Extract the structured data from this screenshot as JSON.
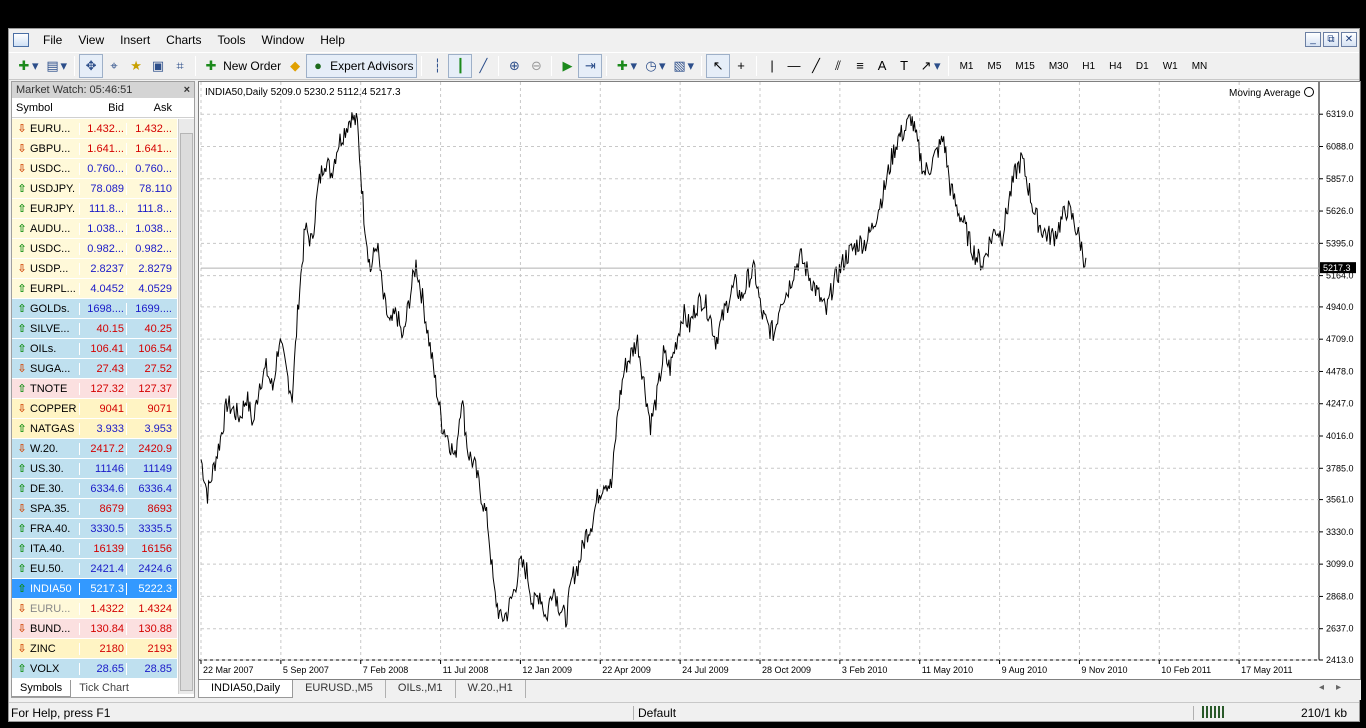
{
  "menu": [
    "File",
    "View",
    "Insert",
    "Charts",
    "Tools",
    "Window",
    "Help"
  ],
  "window_controls": [
    "_",
    "⧉",
    "✕"
  ],
  "toolbar": {
    "new_order": "New Order",
    "expert_advisors": "Expert Advisors",
    "timeframes": [
      "M1",
      "M5",
      "M15",
      "M30",
      "H1",
      "H4",
      "D1",
      "W1",
      "MN"
    ]
  },
  "market_watch": {
    "title": "Market Watch: 05:46:51",
    "close": "×",
    "headers": {
      "symbol": "Symbol",
      "bid": "Bid",
      "ask": "Ask"
    },
    "rows": [
      {
        "symbol": "EURU...",
        "bid": "1.432...",
        "ask": "1.432...",
        "dir": "down",
        "color": "red",
        "bg": "#fff9d9"
      },
      {
        "symbol": "GBPU...",
        "bid": "1.641...",
        "ask": "1.641...",
        "dir": "down",
        "color": "red",
        "bg": "#fff9d9"
      },
      {
        "symbol": "USDC...",
        "bid": "0.760...",
        "ask": "0.760...",
        "dir": "down",
        "color": "blue",
        "bg": "#fff9d9"
      },
      {
        "symbol": "USDJPY.",
        "bid": "78.089",
        "ask": "78.110",
        "dir": "up",
        "color": "blue",
        "bg": "#fff9d9"
      },
      {
        "symbol": "EURJPY.",
        "bid": "111.8...",
        "ask": "111.8...",
        "dir": "up",
        "color": "blue",
        "bg": "#fff9d9"
      },
      {
        "symbol": "AUDU...",
        "bid": "1.038...",
        "ask": "1.038...",
        "dir": "up",
        "color": "blue",
        "bg": "#fff9d9"
      },
      {
        "symbol": "USDC...",
        "bid": "0.982...",
        "ask": "0.982...",
        "dir": "up",
        "color": "blue",
        "bg": "#fff9d9"
      },
      {
        "symbol": "USDP...",
        "bid": "2.8237",
        "ask": "2.8279",
        "dir": "down",
        "color": "blue",
        "bg": "#fff9d9"
      },
      {
        "symbol": "EURPL...",
        "bid": "4.0452",
        "ask": "4.0529",
        "dir": "up",
        "color": "blue",
        "bg": "#fff9d9"
      },
      {
        "symbol": "GOLDs.",
        "bid": "1698....",
        "ask": "1699....",
        "dir": "up",
        "color": "blue",
        "bg": "#bfe0ef"
      },
      {
        "symbol": "SILVE...",
        "bid": "40.15",
        "ask": "40.25",
        "dir": "up",
        "color": "red",
        "bg": "#bfe0ef"
      },
      {
        "symbol": "OILs.",
        "bid": "106.41",
        "ask": "106.54",
        "dir": "up",
        "color": "red",
        "bg": "#bfe0ef"
      },
      {
        "symbol": "SUGA...",
        "bid": "27.43",
        "ask": "27.52",
        "dir": "down",
        "color": "red",
        "bg": "#bfe0ef"
      },
      {
        "symbol": "TNOTE",
        "bid": "127.32",
        "ask": "127.37",
        "dir": "up",
        "color": "red",
        "bg": "#fbe0e0"
      },
      {
        "symbol": "COPPER",
        "bid": "9041",
        "ask": "9071",
        "dir": "down",
        "color": "red",
        "bg": "#fff4c4"
      },
      {
        "symbol": "NATGAS",
        "bid": "3.933",
        "ask": "3.953",
        "dir": "up",
        "color": "blue",
        "bg": "#fff4c4"
      },
      {
        "symbol": "W.20.",
        "bid": "2417.2",
        "ask": "2420.9",
        "dir": "down",
        "color": "red",
        "bg": "#bfe0ef"
      },
      {
        "symbol": "US.30.",
        "bid": "11146",
        "ask": "11149",
        "dir": "up",
        "color": "blue",
        "bg": "#bfe0ef"
      },
      {
        "symbol": "DE.30.",
        "bid": "6334.6",
        "ask": "6336.4",
        "dir": "up",
        "color": "blue",
        "bg": "#bfe0ef"
      },
      {
        "symbol": "SPA.35.",
        "bid": "8679",
        "ask": "8693",
        "dir": "down",
        "color": "red",
        "bg": "#bfe0ef"
      },
      {
        "symbol": "FRA.40.",
        "bid": "3330.5",
        "ask": "3335.5",
        "dir": "up",
        "color": "blue",
        "bg": "#bfe0ef"
      },
      {
        "symbol": "ITA.40.",
        "bid": "16139",
        "ask": "16156",
        "dir": "up",
        "color": "red",
        "bg": "#bfe0ef"
      },
      {
        "symbol": "EU.50.",
        "bid": "2421.4",
        "ask": "2424.6",
        "dir": "up",
        "color": "blue",
        "bg": "#bfe0ef"
      },
      {
        "symbol": "INDIA50",
        "bid": "5217.3",
        "ask": "5222.3",
        "dir": "up",
        "color": "white",
        "bg": "#3399ff"
      },
      {
        "symbol": "EURU...",
        "bid": "1.4322",
        "ask": "1.4324",
        "dir": "down",
        "color": "red",
        "bg": "#fff9d9",
        "dim": true
      },
      {
        "symbol": "BUND...",
        "bid": "130.84",
        "ask": "130.88",
        "dir": "down",
        "color": "red",
        "bg": "#fbe0e0"
      },
      {
        "symbol": "ZINC",
        "bid": "2180",
        "ask": "2193",
        "dir": "down",
        "color": "red",
        "bg": "#fff4c4"
      },
      {
        "symbol": "VOLX",
        "bid": "28.65",
        "ask": "28.85",
        "dir": "up",
        "color": "blue",
        "bg": "#bfe0ef"
      }
    ],
    "tabs": [
      "Symbols",
      "Tick Chart"
    ]
  },
  "chart": {
    "header": "INDIA50,Daily  5209.0 5230.2 5112.4 5217.3",
    "indicator": "Moving Average",
    "current_price": "5217.3",
    "tabs": [
      "INDIA50,Daily",
      "EURUSD.,M5",
      "OILs.,M1",
      "W.20.,H1"
    ]
  },
  "chart_data": {
    "type": "line",
    "title": "",
    "ylim": [
      2413.0,
      6435.0
    ],
    "y_ticks": [
      "6319.0",
      "6088.0",
      "5857.0",
      "5626.0",
      "5395.0",
      "5164.0",
      "4940.0",
      "4709.0",
      "4478.0",
      "4247.0",
      "4016.0",
      "3785.0",
      "3561.0",
      "3330.0",
      "3099.0",
      "2868.0",
      "2637.0",
      "2413.0"
    ],
    "x_ticks": [
      "22 Mar 2007",
      "5 Sep 2007",
      "7 Feb 2008",
      "11 Jul 2008",
      "12 Jan 2009",
      "22 Apr 2009",
      "24 Jul 2009",
      "28 Oct 2009",
      "3 Feb 2010",
      "11 May 2010",
      "9 Aug 2010",
      "9 Nov 2010",
      "10 Feb 2011",
      "17 May 2011"
    ],
    "series": [
      {
        "values": [
          3850,
          3600,
          3800,
          4000,
          4250,
          4200,
          4150,
          4300,
          4100,
          4400,
          4500,
          4350,
          4700,
          4500,
          4300,
          5000,
          5500,
          5400,
          5800,
          6000,
          5900,
          6100,
          6200,
          6300,
          6250,
          5600,
          5200,
          5400,
          5000,
          4800,
          4900,
          4700,
          5000,
          5250,
          5000,
          4700,
          4400,
          4100,
          4000,
          3850,
          4300,
          3900,
          3800,
          3600,
          3400,
          2900,
          2700,
          2750,
          2900,
          3100,
          3050,
          2800,
          2900,
          2700,
          2950,
          2800,
          2700,
          3000,
          3100,
          3300,
          3400,
          3600,
          3700,
          3650,
          4200,
          4500,
          4600,
          4700,
          4400,
          4100,
          4300,
          4600,
          4500,
          4700,
          4900,
          4800,
          4950,
          5000,
          4900,
          4700,
          4850,
          5000,
          5100,
          5000,
          5150,
          5200,
          4900,
          4800,
          4750,
          5000,
          5050,
          5200,
          5300,
          5200,
          5100,
          5000,
          4900,
          5100,
          5200,
          5300,
          5350,
          5400,
          5400,
          5500,
          5650,
          5800,
          6000,
          6150,
          6200,
          6300,
          6100,
          5900,
          5950,
          6050,
          6150,
          5800,
          5650,
          5550,
          5400,
          5300,
          5250,
          5400,
          5500,
          5450,
          5700,
          5900,
          6000,
          5800,
          5600,
          5500,
          5450,
          5450,
          5550,
          5650,
          5550,
          5400,
          5200
        ]
      }
    ]
  }
}
